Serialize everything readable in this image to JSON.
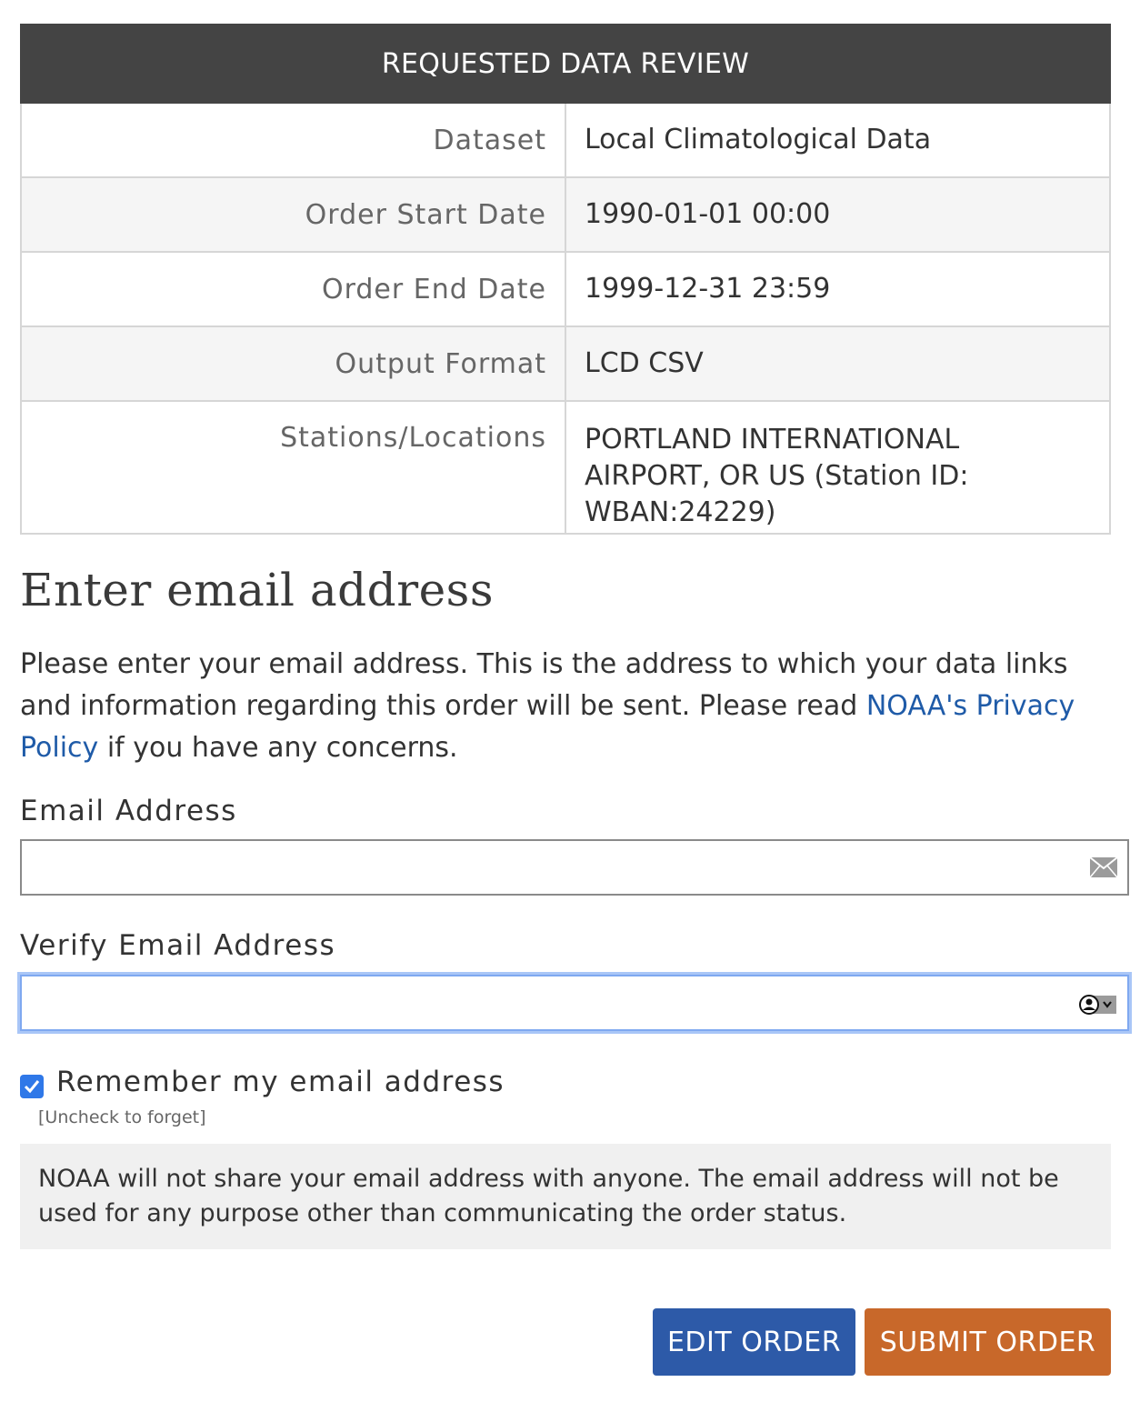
{
  "review": {
    "heading": "REQUESTED DATA REVIEW",
    "rows": [
      {
        "label": "Dataset",
        "value": "Local Climatological Data"
      },
      {
        "label": "Order Start Date",
        "value": "1990-01-01 00:00"
      },
      {
        "label": "Order End Date",
        "value": "1999-12-31 23:59"
      },
      {
        "label": "Output Format",
        "value": "LCD CSV"
      },
      {
        "label": "Stations/Locations",
        "value": "PORTLAND INTERNATIONAL AIRPORT, OR US (Station ID: WBAN:24229)"
      }
    ]
  },
  "email_section": {
    "title": "Enter email address",
    "intro_before": "Please enter your email address. This is the address to which your data links and information regarding this order will be sent. Please read ",
    "privacy_link": "NOAA's Privacy Policy",
    "intro_after": " if you have any concerns.",
    "email_label": "Email Address",
    "email_value": "",
    "verify_label": "Verify Email Address",
    "verify_value": "",
    "remember_label": "Remember my email address",
    "remember_checked": true,
    "remember_hint": "[Uncheck to forget]",
    "notice": "NOAA will not share your email address with anyone. The email address will not be used for any purpose other than communicating the order status."
  },
  "icons": {
    "email_field_icon": "envelope-icon",
    "verify_field_icon": "autofill-contact-icon",
    "checkbox_icon": "checkmark-icon"
  },
  "colors": {
    "header_bg": "#444444",
    "link": "#1f5ba8",
    "edit_button": "#2d5aa8",
    "submit_button": "#c8682a",
    "checkbox": "#2f78e8"
  },
  "actions": {
    "edit_label": "EDIT ORDER",
    "submit_label": "SUBMIT ORDER"
  }
}
